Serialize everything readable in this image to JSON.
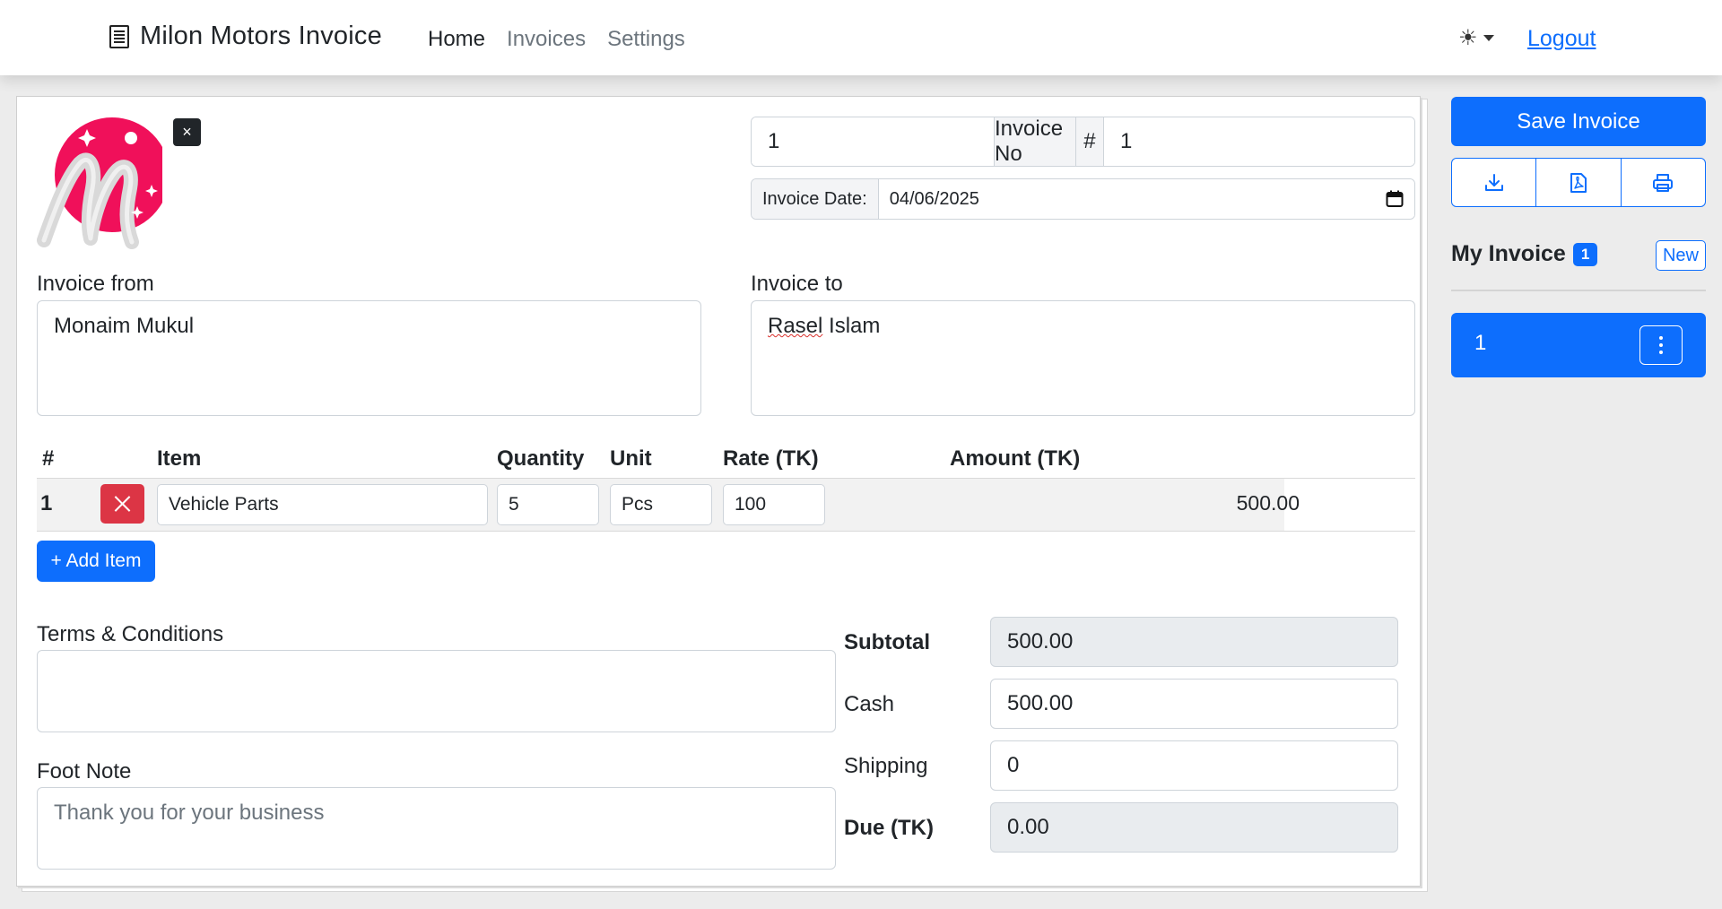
{
  "app": {
    "brand": "Milon Motors Invoice",
    "nav": [
      "Home",
      "Invoices",
      "Settings"
    ],
    "theme_icon": "☀",
    "logout": "Logout"
  },
  "invoice": {
    "number_left": "1",
    "number_label": "Invoice No",
    "hash": "#",
    "number_right": "1",
    "date_label": "Invoice Date:",
    "date_value": "04/06/2025",
    "from_label": "Invoice from",
    "from_value": "Monaim Mukul",
    "to_label": "Invoice to",
    "to_first": "Rasel",
    "to_rest": " Islam"
  },
  "items": {
    "headers": {
      "num": "#",
      "item": "Item",
      "quantity": "Quantity",
      "unit": "Unit",
      "rate": "Rate (TK)",
      "amount": "Amount (TK)"
    },
    "rows": [
      {
        "num": "1",
        "item": "Vehicle Parts",
        "quantity": "5",
        "unit": "Pcs",
        "rate": "100",
        "amount": "500.00"
      }
    ],
    "add_label": "+ Add Item"
  },
  "notes": {
    "terms_label": "Terms & Conditions",
    "terms_value": "",
    "foot_label": "Foot Note",
    "foot_placeholder": "Thank you for your business"
  },
  "totals": {
    "subtotal_label": "Subtotal",
    "subtotal_value": "500.00",
    "cash_label": "Cash",
    "cash_value": "500.00",
    "shipping_label": "Shipping",
    "shipping_value": "0",
    "due_label": "Due (TK)",
    "due_value": "0.00"
  },
  "sidebar": {
    "save_label": "Save Invoice",
    "my_invoice_label": "My Invoice",
    "count": "1",
    "new_label": "New",
    "invoices": [
      {
        "label": "1"
      }
    ]
  },
  "colors": {
    "primary": "#0d6efd",
    "danger": "#dc3545",
    "logo_pink": "#f0105a"
  }
}
